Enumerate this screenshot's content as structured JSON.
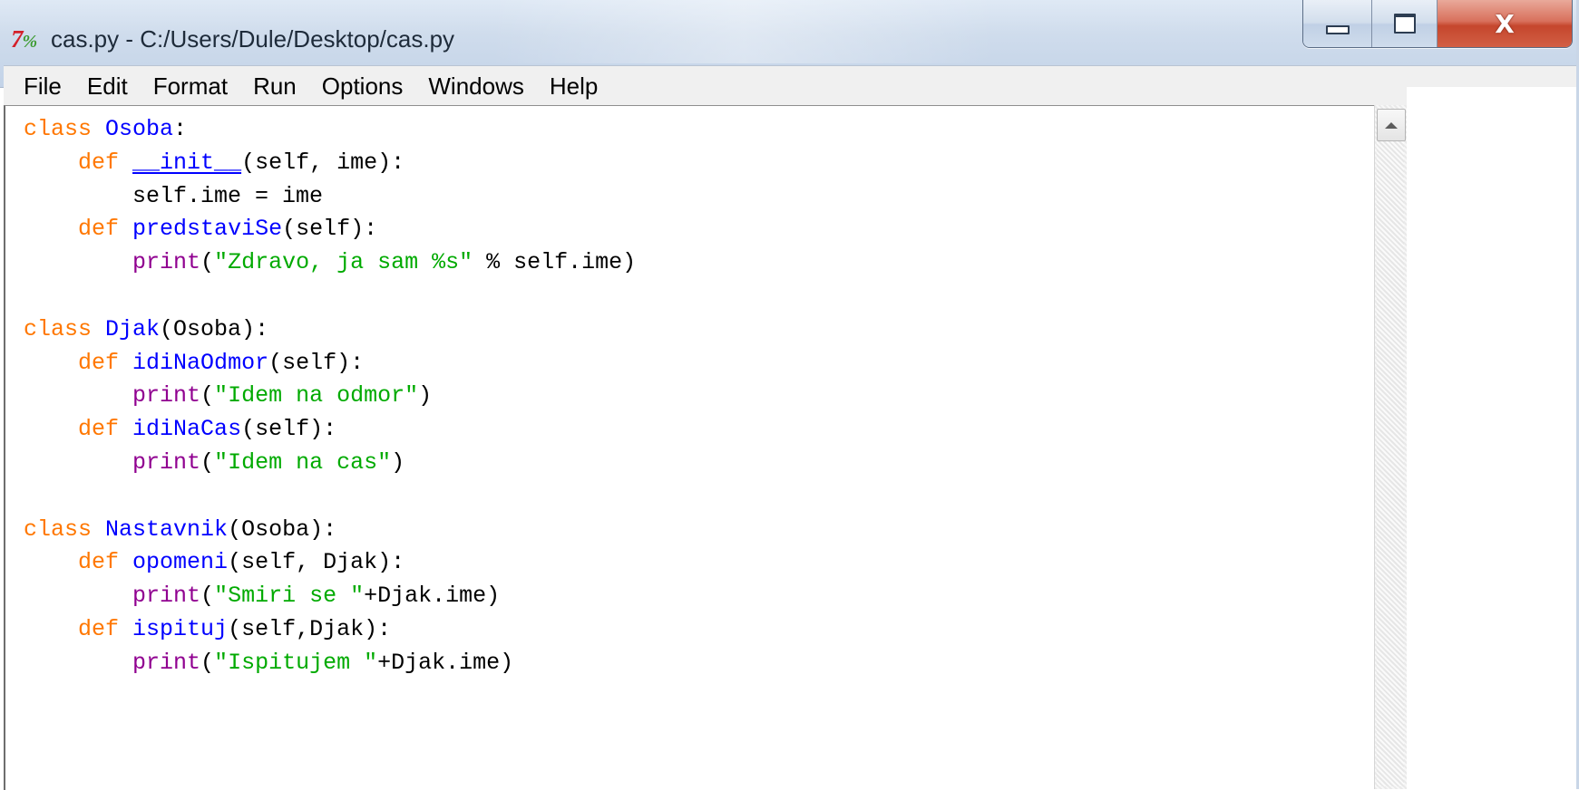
{
  "window": {
    "title": "cas.py - C:/Users/Dule/Desktop/cas.py",
    "icon": "idle-python-icon",
    "controls": {
      "minimize": "_",
      "maximize": "□",
      "close": "X"
    }
  },
  "menubar": {
    "items": [
      {
        "label": "File"
      },
      {
        "label": "Edit"
      },
      {
        "label": "Format"
      },
      {
        "label": "Run"
      },
      {
        "label": "Options"
      },
      {
        "label": "Windows"
      },
      {
        "label": "Help"
      }
    ]
  },
  "editor": {
    "lines": [
      [
        {
          "t": "class",
          "c": "kw"
        },
        {
          "t": " "
        },
        {
          "t": "Osoba",
          "c": "nm"
        },
        {
          "t": ":"
        }
      ],
      [
        {
          "t": "    "
        },
        {
          "t": "def",
          "c": "kw"
        },
        {
          "t": " "
        },
        {
          "t": "__init__",
          "c": "nm magic"
        },
        {
          "t": "(self, ime):"
        }
      ],
      [
        {
          "t": "        self.ime = ime"
        }
      ],
      [
        {
          "t": "    "
        },
        {
          "t": "def",
          "c": "kw"
        },
        {
          "t": " "
        },
        {
          "t": "predstaviSe",
          "c": "nm"
        },
        {
          "t": "(self):"
        }
      ],
      [
        {
          "t": "        "
        },
        {
          "t": "print",
          "c": "bi"
        },
        {
          "t": "("
        },
        {
          "t": "\"Zdravo, ja sam %s\"",
          "c": "st"
        },
        {
          "t": " % self.ime)"
        }
      ],
      [],
      [
        {
          "t": "class",
          "c": "kw"
        },
        {
          "t": " "
        },
        {
          "t": "Djak",
          "c": "nm"
        },
        {
          "t": "(Osoba):"
        }
      ],
      [
        {
          "t": "    "
        },
        {
          "t": "def",
          "c": "kw"
        },
        {
          "t": " "
        },
        {
          "t": "idiNaOdmor",
          "c": "nm"
        },
        {
          "t": "(self):"
        }
      ],
      [
        {
          "t": "        "
        },
        {
          "t": "print",
          "c": "bi"
        },
        {
          "t": "("
        },
        {
          "t": "\"Idem na odmor\"",
          "c": "st"
        },
        {
          "t": ")"
        }
      ],
      [
        {
          "t": "    "
        },
        {
          "t": "def",
          "c": "kw"
        },
        {
          "t": " "
        },
        {
          "t": "idiNaCas",
          "c": "nm"
        },
        {
          "t": "(self):"
        }
      ],
      [
        {
          "t": "        "
        },
        {
          "t": "print",
          "c": "bi"
        },
        {
          "t": "("
        },
        {
          "t": "\"Idem na cas\"",
          "c": "st"
        },
        {
          "t": ")"
        }
      ],
      [],
      [
        {
          "t": "class",
          "c": "kw"
        },
        {
          "t": " "
        },
        {
          "t": "Nastavnik",
          "c": "nm"
        },
        {
          "t": "(Osoba):"
        }
      ],
      [
        {
          "t": "    "
        },
        {
          "t": "def",
          "c": "kw"
        },
        {
          "t": " "
        },
        {
          "t": "opomeni",
          "c": "nm"
        },
        {
          "t": "(self, Djak):"
        }
      ],
      [
        {
          "t": "        "
        },
        {
          "t": "print",
          "c": "bi"
        },
        {
          "t": "("
        },
        {
          "t": "\"Smiri se \"",
          "c": "st"
        },
        {
          "t": "+Djak.ime)"
        }
      ],
      [
        {
          "t": "    "
        },
        {
          "t": "def",
          "c": "kw"
        },
        {
          "t": " "
        },
        {
          "t": "ispituj",
          "c": "nm"
        },
        {
          "t": "(self,Djak):"
        }
      ],
      [
        {
          "t": "        "
        },
        {
          "t": "print",
          "c": "bi"
        },
        {
          "t": "("
        },
        {
          "t": "\"Ispitujem \"",
          "c": "st"
        },
        {
          "t": "+Djak.ime)"
        }
      ]
    ]
  },
  "colors": {
    "keyword": "#ff7700",
    "definition": "#0000ff",
    "builtin": "#900090",
    "string": "#00aa00",
    "text": "#000000"
  }
}
